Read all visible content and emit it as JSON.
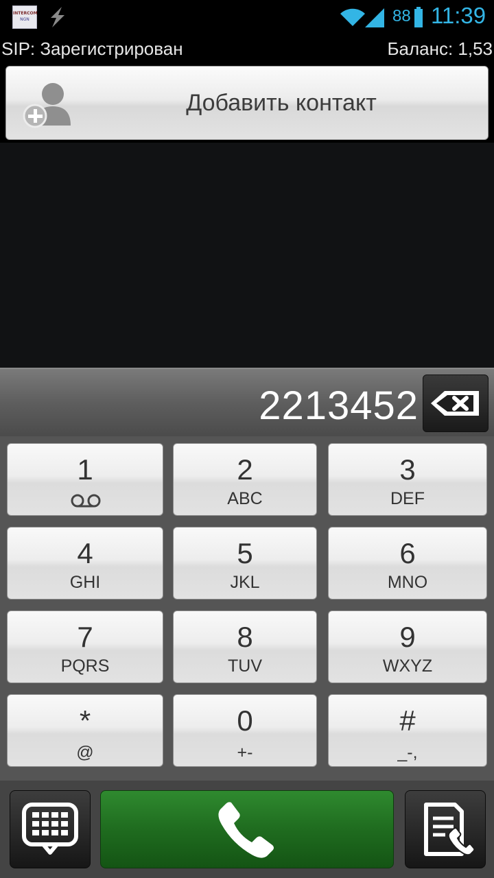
{
  "status_bar": {
    "app_icon_line1": "INTERCOM",
    "app_icon_line2": "NGN",
    "battery_level": "88",
    "time": "11:39",
    "accent_color": "#33b5e5"
  },
  "sip": {
    "status": "SIP: Зарегистрирован",
    "balance": "Баланс: 1,53"
  },
  "add_contact": {
    "label": "Добавить контакт"
  },
  "dialer": {
    "number": "2213452",
    "keys": [
      {
        "digit": "1",
        "letters": ""
      },
      {
        "digit": "2",
        "letters": "ABC"
      },
      {
        "digit": "3",
        "letters": "DEF"
      },
      {
        "digit": "4",
        "letters": "GHI"
      },
      {
        "digit": "5",
        "letters": "JKL"
      },
      {
        "digit": "6",
        "letters": "MNO"
      },
      {
        "digit": "7",
        "letters": "PQRS"
      },
      {
        "digit": "8",
        "letters": "TUV"
      },
      {
        "digit": "9",
        "letters": "WXYZ"
      },
      {
        "digit": "*",
        "letters": "@"
      },
      {
        "digit": "0",
        "letters": "+-"
      },
      {
        "digit": "#",
        "letters": "_-,"
      }
    ]
  },
  "bottom_bar": {
    "icons": [
      "dialpad-toggle-icon",
      "phone-call-icon",
      "call-log-icon"
    ],
    "call_color": "#1f6c1f"
  }
}
